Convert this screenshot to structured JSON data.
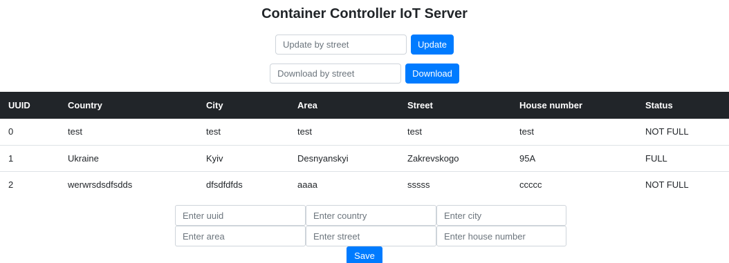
{
  "page": {
    "title": "Container Controller IoT Server"
  },
  "update_form": {
    "placeholder": "Update by street",
    "button_label": "Update"
  },
  "download_form": {
    "placeholder": "Download by street",
    "button_label": "Download"
  },
  "table": {
    "headers": [
      "UUID",
      "Country",
      "City",
      "Area",
      "Street",
      "House number",
      "Status"
    ],
    "rows": [
      [
        "0",
        "test",
        "test",
        "test",
        "test",
        "test",
        "NOT FULL"
      ],
      [
        "1",
        "Ukraine",
        "Kyiv",
        "Desnyanskyi",
        "Zakrevskogo",
        "95A",
        "FULL"
      ],
      [
        "2",
        "werwrsdsdfsdds",
        "dfsdfdfds",
        "aaaa",
        "sssss",
        "ccccc",
        "NOT FULL"
      ]
    ]
  },
  "create_form": {
    "uuid_placeholder": "Enter uuid",
    "country_placeholder": "Enter country",
    "city_placeholder": "Enter city",
    "area_placeholder": "Enter area",
    "street_placeholder": "Enter street",
    "house_number_placeholder": "Enter house number",
    "save_label": "Save"
  },
  "colors": {
    "primary": "#007bff",
    "table_header_bg": "#212529",
    "border": "#ced4da"
  }
}
